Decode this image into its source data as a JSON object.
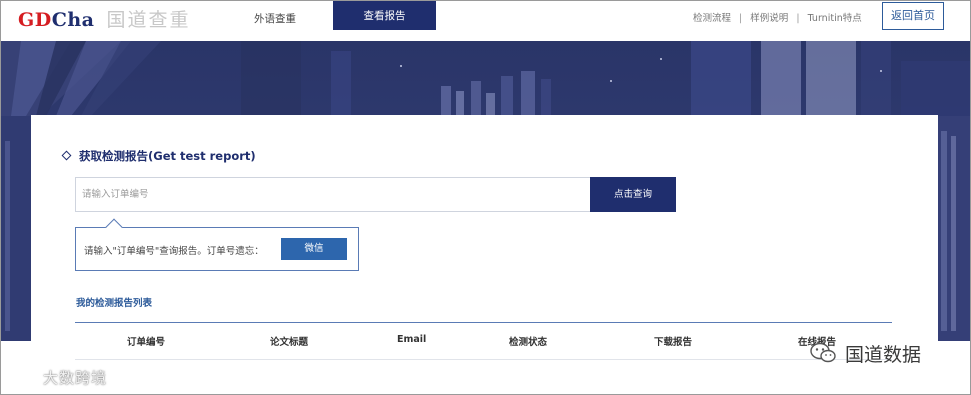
{
  "header": {
    "logo_latin_red": "GD",
    "logo_latin_blue": "Cha",
    "logo_chinese": "国道查重",
    "nav_foreign": "外语查重",
    "nav_view_report": "查看报告",
    "links": [
      "检测流程",
      "样例说明",
      "Turnitin特点"
    ],
    "separator": "|",
    "back_home": "返回首页"
  },
  "card": {
    "section_title": "获取检测报告(Get test report)",
    "search": {
      "placeholder": "请输入订单编号",
      "value": "",
      "button_label": "点击查询"
    },
    "tip": {
      "text": "请输入\"订单编号\"查询报告。订单号遗忘：",
      "button_label": "微信"
    },
    "list_title": "我的检测报告列表",
    "table": {
      "columns": [
        "订单编号",
        "论文标题",
        "Email",
        "检测状态",
        "下载报告",
        "在线报告"
      ],
      "rows": []
    }
  },
  "watermarks": {
    "left": "大数跨境",
    "right": "国道数据"
  },
  "colors": {
    "brand_navy": "#1f2e6e",
    "brand_red": "#d51d22",
    "link_blue": "#2d5b9a",
    "button_blue": "#2d66ad"
  },
  "icons": [
    "diamond-icon",
    "wechat-icon",
    "watermark-logo-icon"
  ]
}
